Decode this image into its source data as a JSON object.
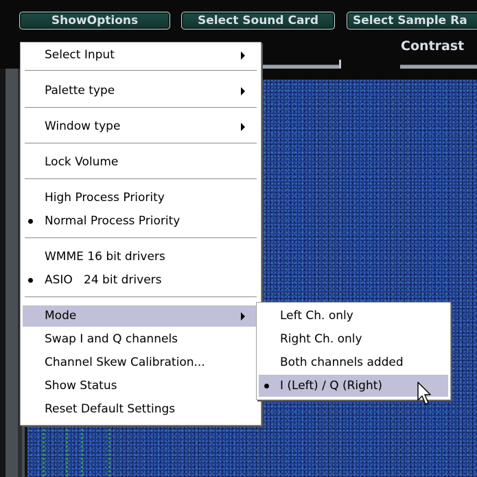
{
  "toolbar": {
    "show_options": "ShowOptions",
    "select_sound_card": "Select Sound Card",
    "select_sample_rate": "Select Sample Ra"
  },
  "contrast_label": "Contrast",
  "main_menu": {
    "select_input": "Select Input",
    "palette_type": "Palette type",
    "window_type": "Window type",
    "lock_volume": "Lock Volume",
    "high_priority": "High Process Priority",
    "normal_priority": "Normal Process Priority",
    "wmme": "WMME 16 bit drivers",
    "asio": "ASIO   24 bit drivers",
    "mode": "Mode",
    "swap_iq": "Swap I and Q channels",
    "skew_cal": "Channel Skew Calibration...",
    "show_status": "Show Status",
    "reset_defaults": "Reset Default Settings"
  },
  "mode_submenu": {
    "left_only": "Left Ch. only",
    "right_only": "Right Ch. only",
    "both_added": "Both channels added",
    "i_q": "I (Left) / Q (Right)"
  },
  "colors": {
    "menu_highlight": "#c0c0d8",
    "button_bg": "#1d4c45",
    "waterfall": "#1e3c8c"
  }
}
